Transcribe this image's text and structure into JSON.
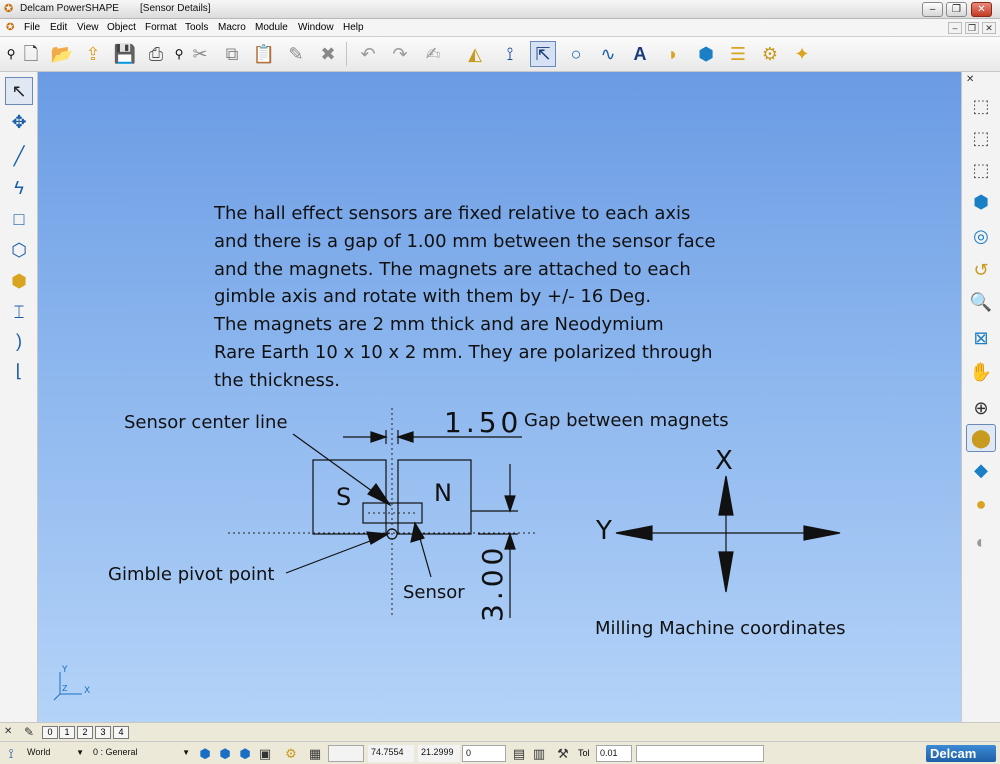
{
  "window": {
    "app_title": "Delcam PowerSHAPE",
    "doc_title": "[Sensor Details]"
  },
  "menu": [
    "File",
    "Edit",
    "View",
    "Object",
    "Format",
    "Tools",
    "Macro",
    "Module",
    "Window",
    "Help"
  ],
  "canvas": {
    "note_lines": [
      "The hall effect sensors are fixed relative to each axis",
      "and there is a gap of 1.00 mm between the sensor face",
      "and the magnets. The magnets are attached to each",
      "gimble axis and rotate with them by +/- 16 Deg.",
      "The magnets are 2 mm thick and are Neodymium",
      "Rare Earth 10 x 10 x 2 mm. They are polarized through",
      "the thickness."
    ],
    "labels": {
      "sensor_center_line": "Sensor center line",
      "gap_between_magnets": "Gap between magnets",
      "gimble_pivot_point": "Gimble pivot point",
      "sensor": "Sensor",
      "milling_coords": "Milling Machine coordinates",
      "magnet_s": "S",
      "magnet_n": "N",
      "axis_x": "X",
      "axis_y": "Y",
      "dim_gap": "1.50",
      "dim_height": "3.00",
      "triad_y": "Y",
      "triad_x": "X",
      "triad_z": "Z"
    }
  },
  "view_tabs": [
    "0",
    "1",
    "2",
    "3",
    "4"
  ],
  "status": {
    "workplane": "World",
    "level": "0 : General",
    "coord_x": "74.7554",
    "coord_y": "21.2999",
    "coord_z": "0",
    "tol_label": "Tol",
    "tol_value": "0.01",
    "brand": "Delcam"
  }
}
